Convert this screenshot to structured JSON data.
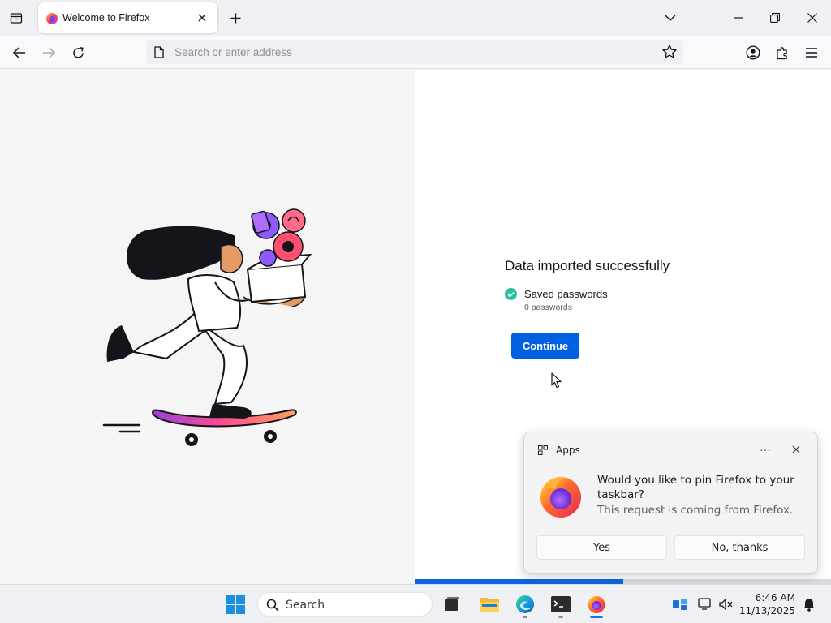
{
  "browser": {
    "tab": {
      "title": "Welcome to Firefox"
    },
    "urlbar": {
      "placeholder": "Search or enter address"
    }
  },
  "welcome": {
    "title": "Data imported successfully",
    "saved_label": "Saved passwords",
    "saved_count": "0 passwords",
    "continue_label": "Continue",
    "progress": 0.5
  },
  "notification": {
    "app": "Apps",
    "more": "···",
    "message": "Would you like to pin Firefox to your taskbar?",
    "sub": "This request is coming from Firefox.",
    "yes_label": "Yes",
    "no_label": "No, thanks"
  },
  "taskbar": {
    "search_label": "Search",
    "time": "6:46 AM",
    "date": "11/13/2025"
  },
  "colors": {
    "accent": "#0061e0",
    "success": "#2ac3a2",
    "firefox_orange": "#ff7139",
    "firefox_purple": "#9059ff"
  },
  "icons": [
    "tab-list-icon",
    "firefox-icon",
    "close-icon",
    "plus-icon",
    "chevron-down-icon",
    "minimize-icon",
    "restore-icon",
    "back-icon",
    "forward-icon",
    "reload-icon",
    "page-icon",
    "star-icon",
    "account-icon",
    "extensions-icon",
    "menu-icon",
    "check-icon",
    "more-icon",
    "windows-start-icon",
    "search-icon",
    "task-view-icon",
    "file-explorer-icon",
    "edge-icon",
    "terminal-icon",
    "widgets-icon",
    "network-icon",
    "notification-bell-icon"
  ]
}
